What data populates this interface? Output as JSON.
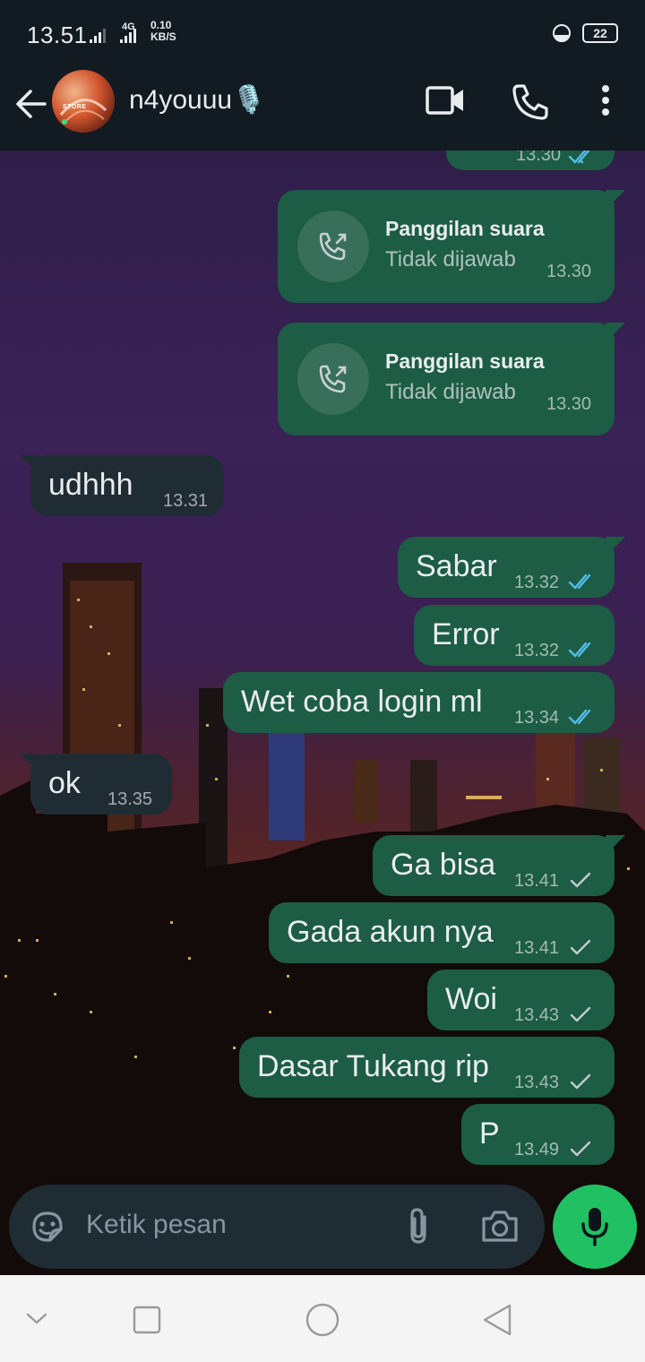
{
  "status_bar": {
    "time": "13.51",
    "network_type": "4G",
    "speed_value": "0.10",
    "speed_unit": "KB/S",
    "battery": "22"
  },
  "header": {
    "contact_name": "n4youuu🎙️",
    "avatar_text": "STORE"
  },
  "messages": [
    {
      "direction": "out",
      "time": "13.30",
      "status": "read"
    },
    {
      "direction": "out",
      "type": "call",
      "title": "Panggilan suara",
      "subtitle": "Tidak dijawab",
      "time": "13.30"
    },
    {
      "direction": "out",
      "type": "call",
      "title": "Panggilan suara",
      "subtitle": "Tidak dijawab",
      "time": "13.30"
    },
    {
      "direction": "in",
      "text": "udhhh",
      "time": "13.31"
    },
    {
      "direction": "out",
      "text": "Sabar",
      "time": "13.32",
      "status": "read"
    },
    {
      "direction": "out",
      "text": "Error",
      "time": "13.32",
      "status": "read"
    },
    {
      "direction": "out",
      "text": "Wet coba login ml",
      "time": "13.34",
      "status": "read"
    },
    {
      "direction": "in",
      "text": "ok",
      "time": "13.35"
    },
    {
      "direction": "out",
      "text": "Ga bisa",
      "time": "13.41",
      "status": "sent"
    },
    {
      "direction": "out",
      "text": "Gada akun nya",
      "time": "13.41",
      "status": "sent"
    },
    {
      "direction": "out",
      "text": "Woi",
      "time": "13.43",
      "status": "sent"
    },
    {
      "direction": "out",
      "text": "Dasar Tukang rip",
      "time": "13.43",
      "status": "sent"
    },
    {
      "direction": "out",
      "text": "P",
      "time": "13.49",
      "status": "sent"
    }
  ],
  "input": {
    "placeholder": "Ketik pesan"
  },
  "icons": {
    "back": "arrow-left-icon",
    "video": "video-call-icon",
    "voice": "phone-icon",
    "menu": "more-vert-icon",
    "emoji": "sticker-icon",
    "attach": "paperclip-icon",
    "camera": "camera-icon",
    "mic": "mic-icon"
  },
  "colors": {
    "outgoing_bubble": "#1d5c45",
    "incoming_bubble": "#202c33",
    "read_tick": "#53bdeb",
    "mic_button": "#21c063",
    "header_bg": "#111b21"
  }
}
